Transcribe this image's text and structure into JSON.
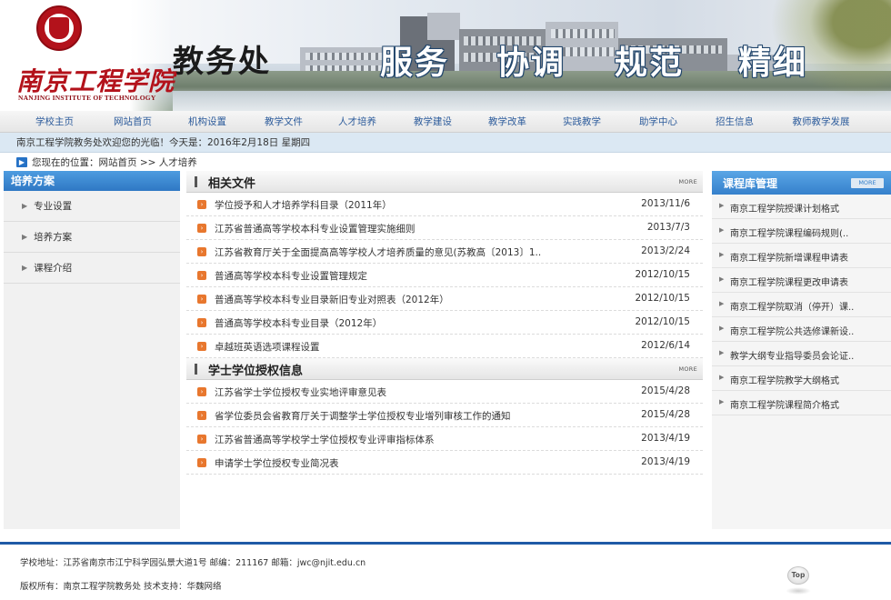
{
  "header": {
    "school_cn": "南京工程学院",
    "school_en": "NANJING INSTITUTE OF TECHNOLOGY",
    "department": "教务处",
    "slogans": [
      "服务",
      "协调",
      "规范",
      "精细"
    ]
  },
  "nav": [
    "学校主页",
    "网站首页",
    "机构设置",
    "教学文件",
    "人才培养",
    "教学建设",
    "教学改革",
    "实践教学",
    "助学中心",
    "招生信息",
    "教师教学发展"
  ],
  "welcome": "南京工程学院教务处欢迎您的光临！今天是：2016年2月18日 星期四",
  "breadcrumb": "您现在的位置：网站首页 >> 人才培养",
  "left": {
    "title": "培养方案",
    "items": [
      "专业设置",
      "培养方案",
      "课程介绍"
    ]
  },
  "sections": [
    {
      "title": "相关文件",
      "more": "MORE",
      "rows": [
        {
          "title": "学位授予和人才培养学科目录（2011年）",
          "date": "2013/11/6"
        },
        {
          "title": "江苏省普通高等学校本科专业设置管理实施细则",
          "date": "2013/7/3"
        },
        {
          "title": "江苏省教育厅关于全面提高高等学校人才培养质量的意见(苏教高〔2013〕1..",
          "date": "2013/2/24"
        },
        {
          "title": "普通高等学校本科专业设置管理规定",
          "date": "2012/10/15"
        },
        {
          "title": "普通高等学校本科专业目录新旧专业对照表（2012年）",
          "date": "2012/10/15"
        },
        {
          "title": "普通高等学校本科专业目录（2012年）",
          "date": "2012/10/15"
        },
        {
          "title": "卓越班英语选项课程设置",
          "date": "2012/6/14"
        }
      ]
    },
    {
      "title": "学士学位授权信息",
      "more": "MORE",
      "rows": [
        {
          "title": "江苏省学士学位授权专业实地评审意见表",
          "date": "2015/4/28"
        },
        {
          "title": "省学位委员会省教育厅关于调整学士学位授权专业增列审核工作的通知",
          "date": "2015/4/28"
        },
        {
          "title": "江苏省普通高等学校学士学位授权专业评审指标体系",
          "date": "2013/4/19"
        },
        {
          "title": "申请学士学位授权专业简况表",
          "date": "2013/4/19"
        }
      ]
    }
  ],
  "right": {
    "title": "课程库管理",
    "more": "MORE",
    "items": [
      "南京工程学院授课计划格式",
      "南京工程学院课程编码规则(..",
      "南京工程学院新增课程申请表",
      "南京工程学院课程更改申请表",
      "南京工程学院取消（停开）课..",
      "南京工程学院公共选修课新设..",
      "教学大纲专业指导委员会论证..",
      "南京工程学院教学大纲格式",
      "南京工程学院课程简介格式"
    ]
  },
  "footer": {
    "address": "学校地址：江苏省南京市江宁科学园弘景大道1号 邮编：211167 邮箱：jwc@njit.edu.cn",
    "copyright": "版权所有：南京工程学院教务处 技术支持：华魏网络",
    "top": "Top"
  },
  "colors": {
    "nav_text": "#2c5b9b",
    "blue_head": "#3580cc",
    "accent_orange": "#e8772e",
    "school_red": "#b3121b",
    "footer_line": "#1f5aa6"
  }
}
